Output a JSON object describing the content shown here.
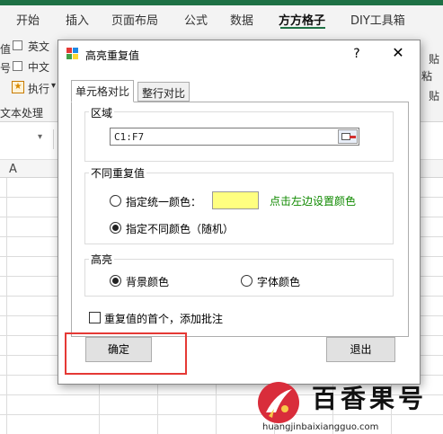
{
  "ribbon": {
    "tabs": [
      "开始",
      "插入",
      "页面布局",
      "公式",
      "数据",
      "方方格子",
      "DIY工具箱"
    ],
    "active_tab": "方方格子",
    "checkbox_en_label": "英文",
    "checkbox_cn_label": "中文",
    "execute_label": "执行",
    "execute_arrow": "▾",
    "group_label": "文本处理",
    "left_fragments": [
      "值",
      "号"
    ],
    "right_fragments": [
      "贴",
      "粘",
      "贴"
    ],
    "accent_color": "#1e7145"
  },
  "sheet": {
    "name_box_arrow": "▾",
    "column_header": "A"
  },
  "dialog": {
    "title": "高亮重复值",
    "help_label": "?",
    "close_label": "✕",
    "tabs": [
      "单元格对比",
      "整行对比"
    ],
    "active_tab": "单元格对比",
    "region": {
      "label": "区域",
      "value": "C1:F7"
    },
    "diff_dup": {
      "label": "不同重复值",
      "option_uniform": "指定统一颜色：",
      "option_random": "指定不同颜色（随机）",
      "selected": "option_random",
      "swatch_color": "#ffff80",
      "color_hint": "点击左边设置颜色"
    },
    "highlight": {
      "label": "高亮",
      "option_bg": "背景颜色",
      "option_font": "字体颜色",
      "selected": "option_bg"
    },
    "comment_checkbox": {
      "label": "重复值的首个，添加批注",
      "checked": false
    },
    "ok_label": "确定",
    "exit_label": "退出"
  },
  "watermark": {
    "text": "百香果号",
    "url": "huangjinbaixiangguo.com"
  }
}
